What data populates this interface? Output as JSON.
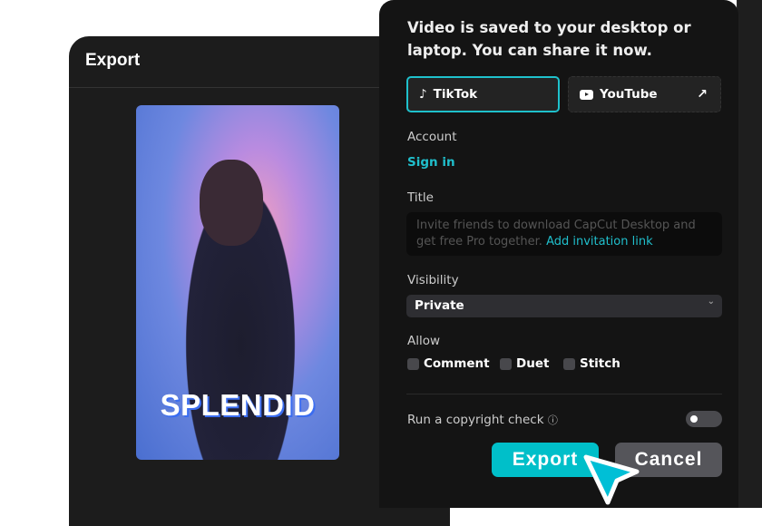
{
  "export_window": {
    "title": "Export",
    "preview_text": "SPLENDID"
  },
  "share_panel": {
    "heading": "Video is saved to your desktop or laptop. You can share it now.",
    "platforms": [
      {
        "label": "TikTok",
        "icon": "tiktok-icon",
        "selected": true
      },
      {
        "label": "YouTube",
        "icon": "youtube-icon",
        "external": "arrow-up-right-icon"
      }
    ],
    "account_label": "Account",
    "sign_in": "Sign in",
    "title_label": "Title",
    "title_placeholder": "Invite friends to download CapCut Desktop and get free Pro together.",
    "invite_link": "Add invitation link",
    "visibility_label": "Visibility",
    "visibility_value": "Private",
    "allow_label": "Allow",
    "allow_options": [
      {
        "label": "Comment",
        "checked": false
      },
      {
        "label": "Duet",
        "checked": false
      },
      {
        "label": "Stitch",
        "checked": false
      }
    ],
    "copyright_label": "Run a copyright check",
    "copyright_enabled": false,
    "export_button": "Export",
    "cancel_button": "Cancel",
    "accent": "#00bfc9"
  }
}
